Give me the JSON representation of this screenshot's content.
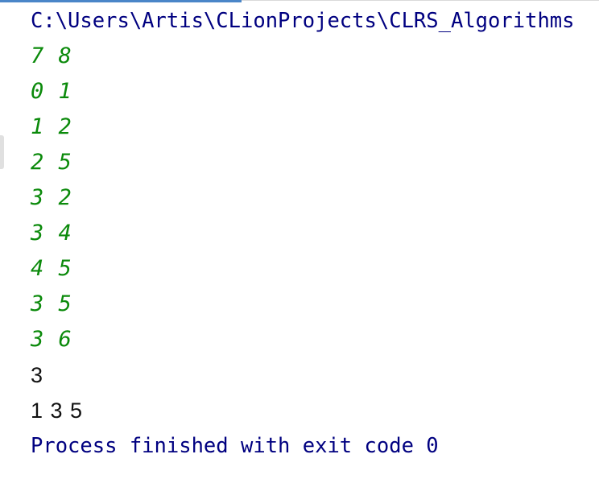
{
  "console": {
    "path_line": "C:\\Users\\Artis\\CLionProjects\\CLRS_Algorithms",
    "input_lines": [
      "7 8",
      "0 1",
      "1 2",
      "2 5",
      "3 2",
      "3 4",
      "4 5",
      "3 5",
      "3 6"
    ],
    "output_lines": [
      "3",
      "1 3 5"
    ],
    "exit_message": "Process finished with exit code 0"
  },
  "colors": {
    "system_text": "#000080",
    "user_input": "#0b8a0b",
    "program_output": "#111111",
    "accent": "#4a86c8"
  }
}
